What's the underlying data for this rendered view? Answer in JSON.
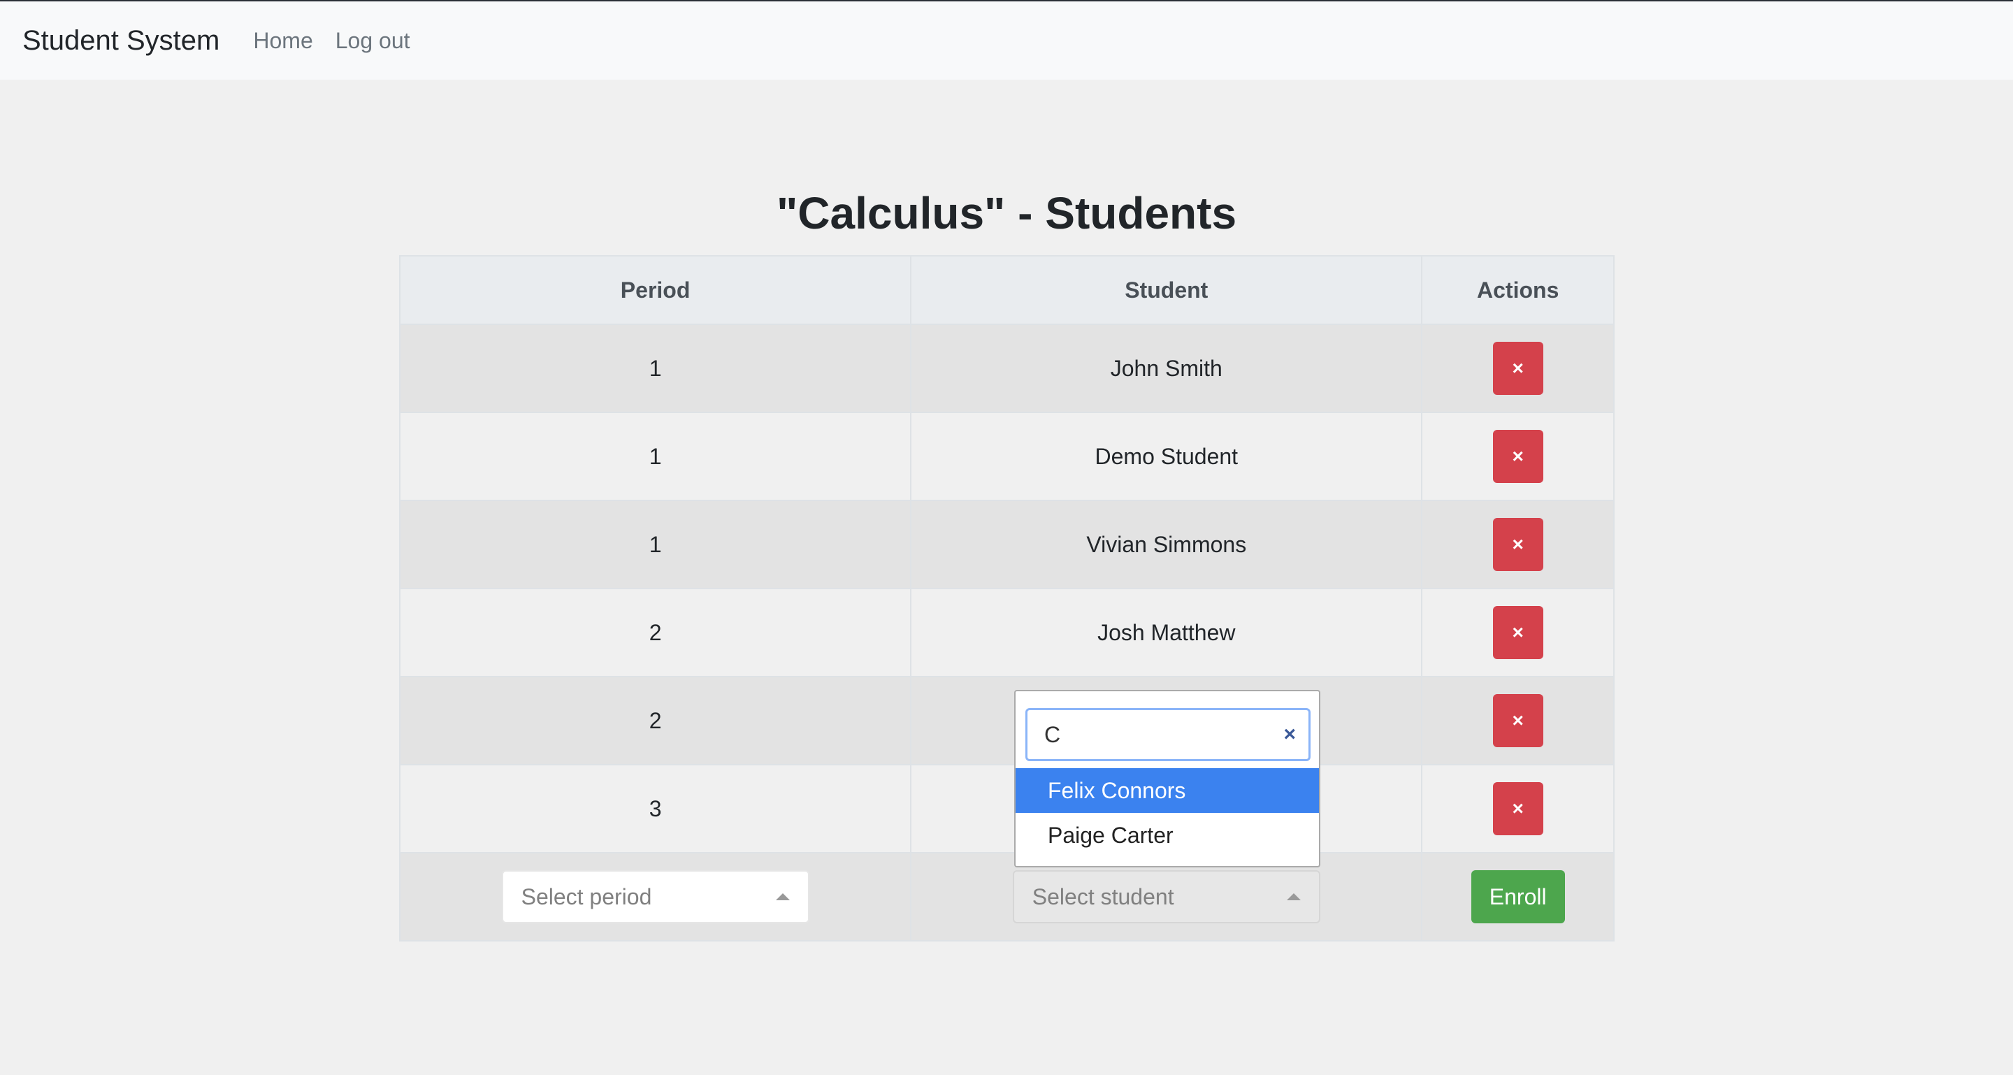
{
  "navbar": {
    "brand": "Student System",
    "links": [
      "Home",
      "Log out"
    ]
  },
  "page": {
    "title": "\"Calculus\" - Students"
  },
  "table": {
    "headers": [
      "Period",
      "Student",
      "Actions"
    ],
    "rows": [
      {
        "period": "1",
        "student": "John Smith",
        "action": "×"
      },
      {
        "period": "1",
        "student": "Demo Student",
        "action": "×"
      },
      {
        "period": "1",
        "student": "Vivian Simmons",
        "action": "×"
      },
      {
        "period": "2",
        "student": "Josh Matthew",
        "action": "×"
      },
      {
        "period": "2",
        "student": "",
        "action": "×"
      },
      {
        "period": "3",
        "student": "",
        "action": "×"
      }
    ]
  },
  "enroll_form": {
    "period_placeholder": "Select period",
    "student_placeholder": "Select student",
    "enroll_label": "Enroll"
  },
  "student_dropdown": {
    "search_value": "C",
    "clear_icon": "×",
    "options": [
      "Felix Connors",
      "Paige Carter"
    ],
    "highlighted_index": 0
  },
  "colors": {
    "delete": "#d4414b",
    "enroll": "#4da64d",
    "highlight": "#3b82ef"
  }
}
